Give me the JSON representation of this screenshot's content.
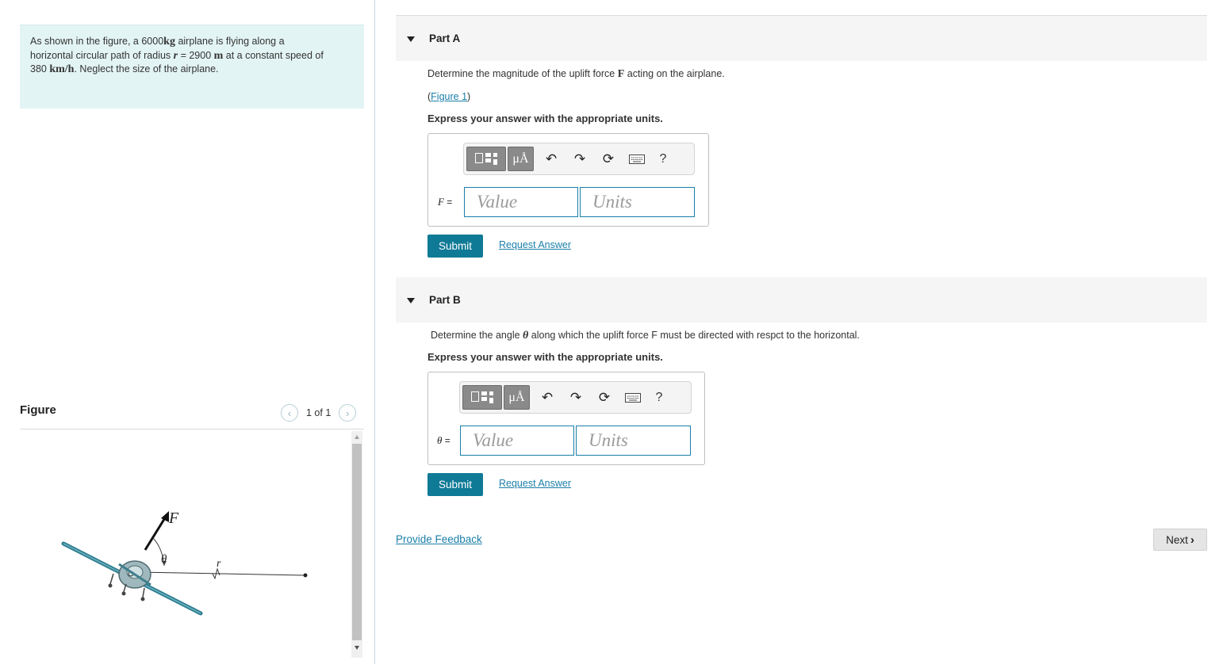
{
  "problem": {
    "text1": "As shown in the figure,  a 6000",
    "text1_unit": "kg",
    "text2": " airplane is flying along a",
    "text3": "horizontal circular path of radius ",
    "r_symbol": "r",
    "r_value": " = 2900 ",
    "r_unit": "m",
    "text4": " at a constant speed of",
    "speed": "380 ",
    "speed_unit": "km/h",
    "text5": ". Neglect the size of the airplane."
  },
  "figure": {
    "label": "Figure",
    "count": "1 of 1",
    "force_label": "F",
    "angle_label": "θ",
    "radius_label": "r"
  },
  "partA": {
    "title": "Part A",
    "question_pre": "Determine the magnitude of the uplift force ",
    "question_symbol": "F",
    "question_post": " acting on the airplane.",
    "figure_link_open": "(",
    "figure_link": "Figure 1",
    "figure_link_close": ")",
    "express": "Express your answer with the appropriate units.",
    "variable": "F",
    "eq": " =",
    "value_placeholder": "Value",
    "units_placeholder": "Units",
    "submit": "Submit",
    "request": "Request Answer"
  },
  "partB": {
    "title": "Part B",
    "question_pre": "Determine the angle ",
    "question_symbol": "θ",
    "question_post": " along which the uplift force F must be directed with respct to the horizontal.",
    "express": "Express your answer with the appropriate units.",
    "variable": "θ",
    "eq": " =",
    "value_placeholder": "Value",
    "units_placeholder": "Units",
    "submit": "Submit",
    "request": "Request Answer"
  },
  "toolbar": {
    "mu_label": "μÅ",
    "help_label": "?",
    "icons": [
      "templates-icon",
      "units-icon",
      "undo-icon",
      "redo-icon",
      "reset-icon",
      "keyboard-icon",
      "help-icon"
    ]
  },
  "footer": {
    "feedback": "Provide Feedback",
    "next": "Next"
  },
  "colors": {
    "accent": "#0f7a96",
    "link": "#1a7fa8",
    "problem_bg": "#e3f4f4",
    "header_bg": "#f5f5f5"
  }
}
